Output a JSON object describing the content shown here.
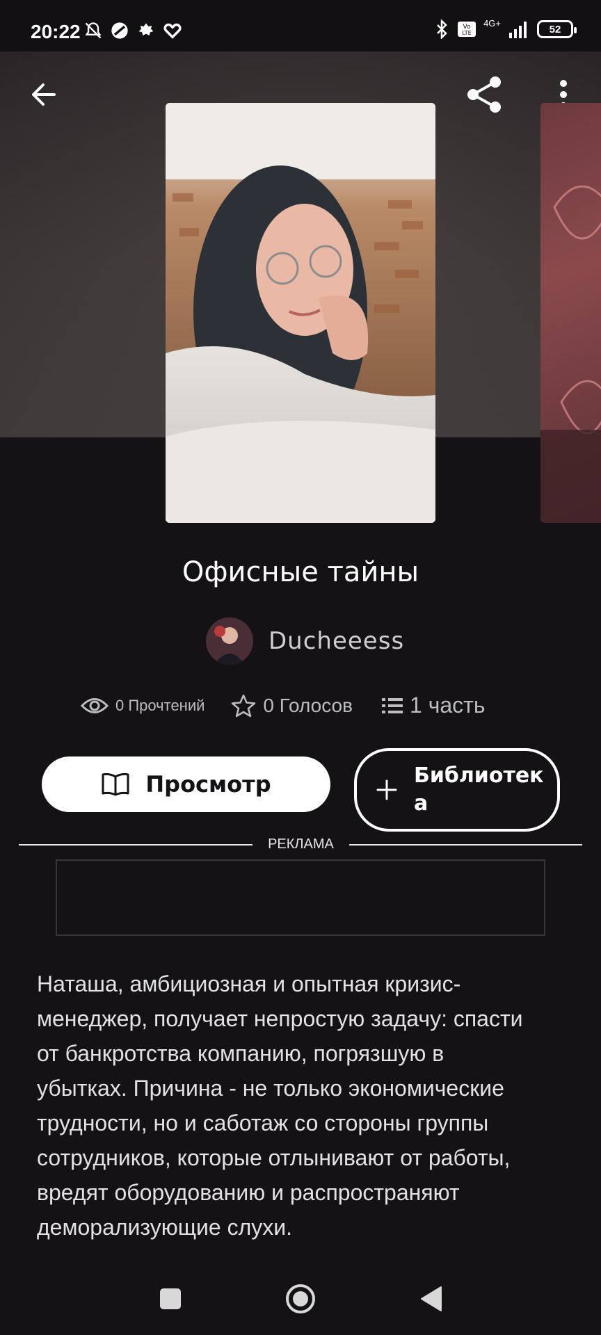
{
  "status_bar": {
    "time": "20:22",
    "left_icons": [
      "mute-alarm-icon",
      "app-icon",
      "leaf-icon",
      "heart-icon"
    ],
    "right_icons": [
      "bluetooth-icon",
      "volte-icon",
      "signal-icon"
    ],
    "network": "4G+",
    "battery": "52"
  },
  "header": {
    "back_icon": "arrow-left-icon",
    "share_icon": "share-icon",
    "menu_icon": "more-vertical-icon"
  },
  "book": {
    "title": "Офисные тайны",
    "author": "Ducheeess",
    "reads": "0 Прочтений",
    "votes": "0 Голосов",
    "parts": "1 часть"
  },
  "actions": {
    "view_label": "Просмотр",
    "library_label": "Библиотека"
  },
  "ad": {
    "label": "РЕКЛАМА"
  },
  "description": "Наташа, амбициозная и опытная кризис-менеджер, получает непростую задачу: спасти от банкротства компанию, погрязшую в убытках. Причина - не только экономические трудности, но и саботаж со стороны группы сотрудников, которые отлынивают от работы, вредят оборудованию и распространяют деморализующие слухи.",
  "nav": {
    "recent_icon": "square-icon",
    "home_icon": "circle-icon",
    "back_icon": "triangle-back-icon"
  },
  "colors": {
    "background": "#141215",
    "accent": "#ffffff",
    "muted_text": "#bdbdbd"
  }
}
